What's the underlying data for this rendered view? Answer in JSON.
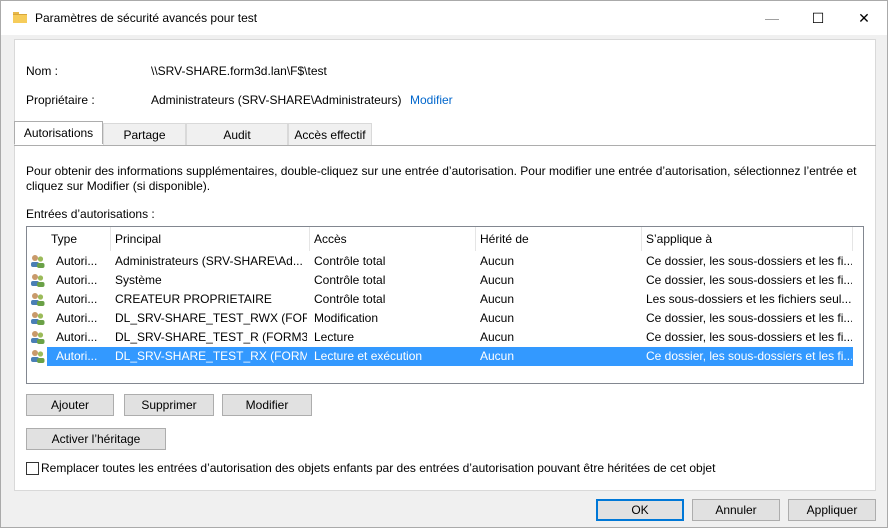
{
  "window": {
    "title": "Paramètres de sécurité avancés pour test",
    "controls": {
      "minimize": "—",
      "maximize": "☐",
      "close": "✕"
    }
  },
  "info": {
    "name_label": "Nom :",
    "name_value": "\\\\SRV-SHARE.form3d.lan\\F$\\test",
    "owner_label": "Propriétaire :",
    "owner_value": "Administrateurs (SRV-SHARE\\Administrateurs)",
    "owner_change_link": "Modifier"
  },
  "tabs": [
    {
      "label": "Autorisations",
      "active": true
    },
    {
      "label": "Partage",
      "active": false
    },
    {
      "label": "Audit",
      "active": false
    },
    {
      "label": "Accès effectif",
      "active": false
    }
  ],
  "permissions": {
    "description": "Pour obtenir des informations supplémentaires, double-cliquez sur une entrée d’autorisation. Pour modifier une entrée d’autorisation, sélectionnez l’entrée et cliquez sur Modifier (si disponible).",
    "entries_label": "Entrées d’autorisations :",
    "columns": [
      "Type",
      "Principal",
      "Accès",
      "Hérité de",
      "S’applique à"
    ],
    "rows": [
      {
        "type": "Autori...",
        "principal": "Administrateurs (SRV-SHARE\\Ad...",
        "access": "Contrôle total",
        "inherited": "Aucun",
        "applies": "Ce dossier, les sous-dossiers et les fi...",
        "selected": false
      },
      {
        "type": "Autori...",
        "principal": "Système",
        "access": "Contrôle total",
        "inherited": "Aucun",
        "applies": "Ce dossier, les sous-dossiers et les fi...",
        "selected": false
      },
      {
        "type": "Autori...",
        "principal": "CREATEUR PROPRIETAIRE",
        "access": "Contrôle total",
        "inherited": "Aucun",
        "applies": "Les sous-dossiers et les fichiers seul...",
        "selected": false
      },
      {
        "type": "Autori...",
        "principal": "DL_SRV-SHARE_TEST_RWX (FOR...",
        "access": "Modification",
        "inherited": "Aucun",
        "applies": "Ce dossier, les sous-dossiers et les fi...",
        "selected": false
      },
      {
        "type": "Autori...",
        "principal": "DL_SRV-SHARE_TEST_R (FORM3...",
        "access": "Lecture",
        "inherited": "Aucun",
        "applies": "Ce dossier, les sous-dossiers et les fi...",
        "selected": false
      },
      {
        "type": "Autori...",
        "principal": "DL_SRV-SHARE_TEST_RX (FORM3...",
        "access": "Lecture et exécution",
        "inherited": "Aucun",
        "applies": "Ce dossier, les sous-dossiers et les fi...",
        "selected": true
      }
    ],
    "buttons": {
      "add": "Ajouter",
      "remove": "Supprimer",
      "modify": "Modifier",
      "enable_inheritance": "Activer l’héritage"
    },
    "replace_checkbox_label": "Remplacer toutes les entrées d’autorisation des objets enfants par des entrées d’autorisation pouvant être héritées de cet objet",
    "replace_checkbox_checked": false
  },
  "footer": {
    "ok": "OK",
    "cancel": "Annuler",
    "apply": "Appliquer"
  },
  "colors": {
    "selection": "#3399ff",
    "link": "#0066cc",
    "default_button_border": "#0078d7"
  }
}
